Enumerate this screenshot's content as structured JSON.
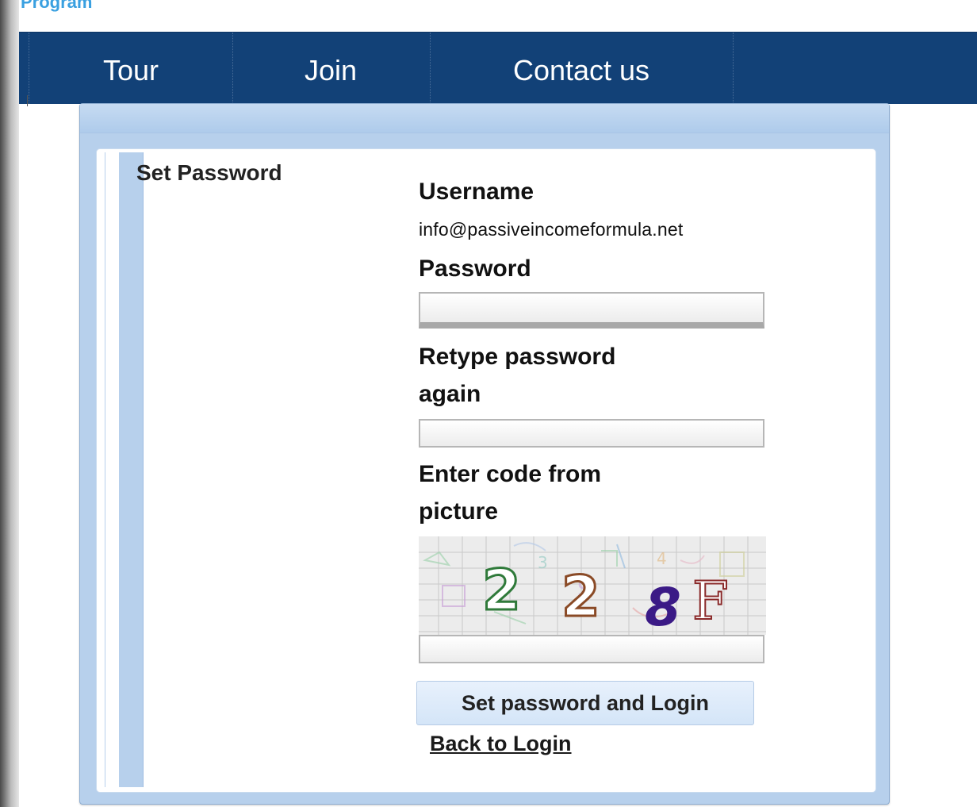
{
  "header": {
    "brand_text": "Program"
  },
  "nav": {
    "items": [
      {
        "label": "Tour"
      },
      {
        "label": "Join"
      },
      {
        "label": "Contact us"
      }
    ]
  },
  "form": {
    "section_title": "Set Password",
    "username_label": "Username",
    "username_value": "info@passiveincomeformula.net",
    "password_label": "Password",
    "password_value": "",
    "retype_label_line1": "Retype password",
    "retype_label_line2": "again",
    "retype_value": "",
    "captcha_label_line1": "Enter code from",
    "captcha_label_line2": "picture",
    "captcha_code": "228F",
    "captcha_value": "",
    "submit_label": "Set password and Login",
    "back_link_label": "Back to Login"
  },
  "colors": {
    "nav_background": "#124177",
    "panel_background": "#b7d0ec",
    "button_background": "#d4e5f8"
  }
}
